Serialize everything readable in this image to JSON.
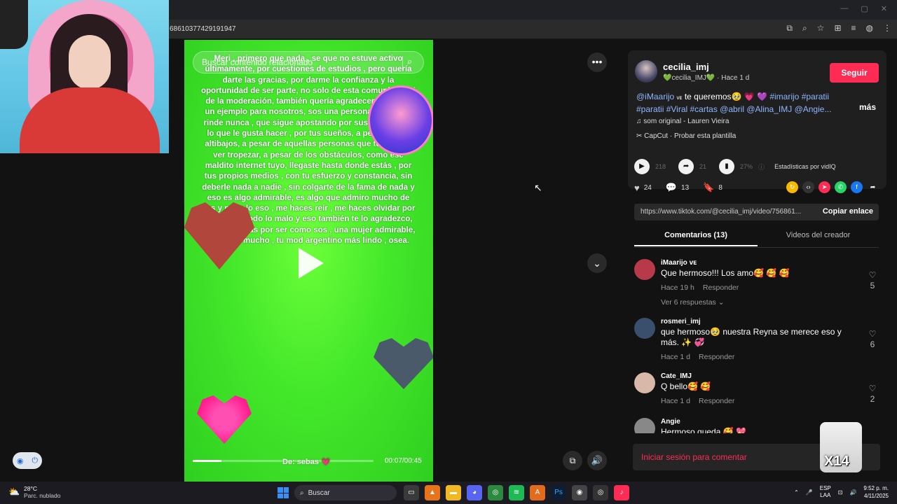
{
  "browser": {
    "url": "68610377429191947",
    "window_controls": [
      "—",
      "▢",
      "✕"
    ]
  },
  "video": {
    "search_placeholder": "Buscar contenido relacionado",
    "overlay_text": "Meri , primero que nada , se que no estuve activo últimamente, por cuestiones de estudios , pero quería darte las gracias, por darme la confianza y la oportunidad de ser parte, no solo de esta comunidad, si de la moderación, también quería agradecerte por ser un ejemplo para nosotros, sos una persona que no se rinde nunca , que sigue apostando por sus metas , por lo que le gusta hacer , por tus sueños, a pesar de los altibajos, a pesar de aquellas personas que te quieren ver tropezar, a pesar de los obstáculos, como ese maldito internet tuyo, llegaste hasta donde estás , por tus propios medios , con tu esfuerzo y constancia, sin deberle nada a nadie , sin colgarte de la fama de nada y eso es algo admirable, es algo que admiro mucho de vos y no solo eso , me haces reír , me haces olvidar por un rato de todo lo malo y eso también te lo agradezco, en fin , gracias por ser como sos , una mujer admirable, te quiere mucho , tu mod argentino más lindo , osea.",
    "signature": "De: sebas 💗",
    "time": "00:07/00:45",
    "progress_fraction": 0.16
  },
  "creator": {
    "name": "cecilia_imj",
    "meta": "💚cecilia_IMJ💚 · Hace 1 d",
    "follow_label": "Seguir",
    "caption_mention": "@iMaarijo",
    "caption_badge": "ᴠᴇ",
    "caption_text": " te queremos🥹 💗 💜 ",
    "caption_tags": "#imarijo #paratii #paratii #Viral #cartas @abril @Alina_IMJ @Angie...",
    "more_label": "más",
    "music": "♫  som original - Lauren Vieira",
    "capcut": "CapCut · Probar esta plantilla"
  },
  "stats": {
    "plays": "218",
    "shares": "21",
    "percent": "27%",
    "label": "Estadísticas por vidIQ"
  },
  "actions": {
    "likes": "24",
    "comments": "13",
    "saves": "8"
  },
  "link": {
    "url": "https://www.tiktok.com/@cecilia_imj/video/756861...",
    "copy_label": "Copiar enlace"
  },
  "tabs": {
    "comments": "Comentarios (13)",
    "videos": "Videos del creador"
  },
  "comments": [
    {
      "name": "iMaarijo ᴠᴇ",
      "text": "Que hermoso!!! Los amo🥰 🥰 🥰",
      "time": "Hace 19 h",
      "reply": "Responder",
      "likes": "5",
      "replies": "Ver 6 respuestas ⌄",
      "color": "#b83a4a"
    },
    {
      "name": "rosmeri_imj",
      "text": "que hermoso🥹 nuestra Reyna se merece eso y más. ✨ 💞",
      "time": "Hace 1 d",
      "reply": "Responder",
      "likes": "6",
      "color": "#3a4f6b"
    },
    {
      "name": "Cate_IMJ",
      "text": "Q bello🥰 🥰",
      "time": "Hace 1 d",
      "reply": "Responder",
      "likes": "2",
      "color": "#d8b8a8"
    },
    {
      "name": "Angie",
      "text": "Hermoso queda 🥰 💖",
      "color": "#888"
    }
  ],
  "login": "Iniciar sesión para comentar",
  "sticker": "X14",
  "taskbar": {
    "temp": "28°C",
    "condition": "Parc. nublado",
    "search": "Buscar",
    "lang_1": "ESP",
    "lang_2": "LAA",
    "time": "9:52 p. m.",
    "date": "4/11/2025"
  },
  "colors": {
    "brand_red": "#fe2c55",
    "video_green": "#44e82a",
    "panel_bg": "#121212"
  }
}
